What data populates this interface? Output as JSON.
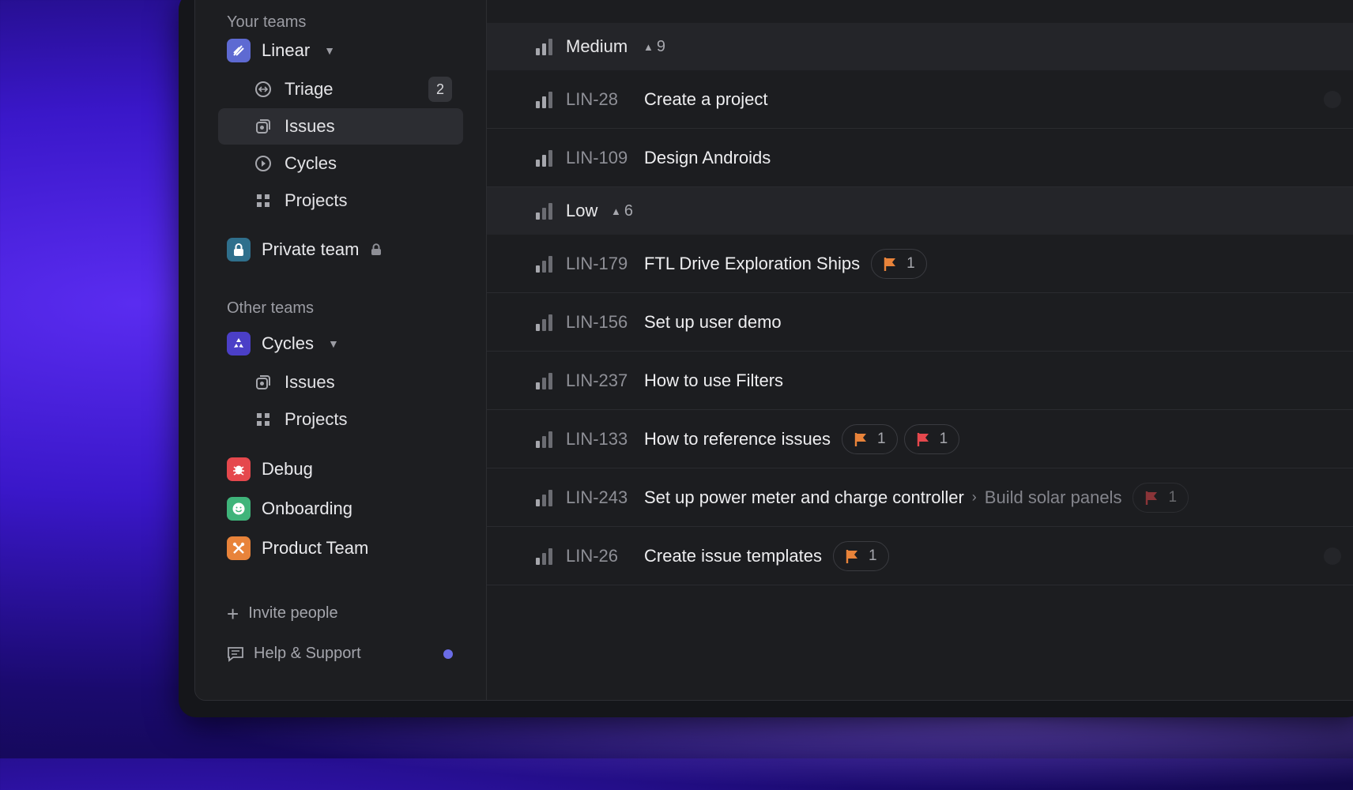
{
  "sidebar": {
    "your_teams_title": "Your teams",
    "linear": {
      "name": "Linear",
      "color": "#5e6ad2",
      "items": [
        {
          "label": "Triage",
          "count": "2"
        },
        {
          "label": "Issues"
        },
        {
          "label": "Cycles"
        },
        {
          "label": "Projects"
        }
      ]
    },
    "private_team": {
      "name": "Private team",
      "color": "#2f6f8c"
    },
    "other_teams_title": "Other teams",
    "cycles_team": {
      "name": "Cycles",
      "color": "#4b3fc7",
      "items": [
        {
          "label": "Issues"
        },
        {
          "label": "Projects"
        }
      ]
    },
    "debug": {
      "name": "Debug",
      "color": "#e5484d"
    },
    "onboarding": {
      "name": "Onboarding",
      "color": "#3fb47a"
    },
    "product_team": {
      "name": "Product Team",
      "color": "#e8833a"
    },
    "invite": "Invite people",
    "help": "Help & Support"
  },
  "groups": [
    {
      "label": "Medium",
      "count": "9",
      "issues": [
        {
          "id": "LIN-28",
          "title": "Create a project"
        },
        {
          "id": "LIN-109",
          "title": "Design Androids"
        }
      ]
    },
    {
      "label": "Low",
      "count": "6",
      "issues": [
        {
          "id": "LIN-179",
          "title": "FTL Drive Exploration Ships",
          "chip1": "1"
        },
        {
          "id": "LIN-156",
          "title": "Set up user demo"
        },
        {
          "id": "LIN-237",
          "title": "How to use Filters"
        },
        {
          "id": "LIN-133",
          "title": "How to reference issues",
          "chip1": "1",
          "chip2": "1"
        },
        {
          "id": "LIN-243",
          "title": "Set up power meter and charge controller",
          "parent": "Build solar panels",
          "chip1": "1"
        },
        {
          "id": "LIN-26",
          "title": "Create issue templates",
          "chip1": "1"
        }
      ]
    }
  ]
}
